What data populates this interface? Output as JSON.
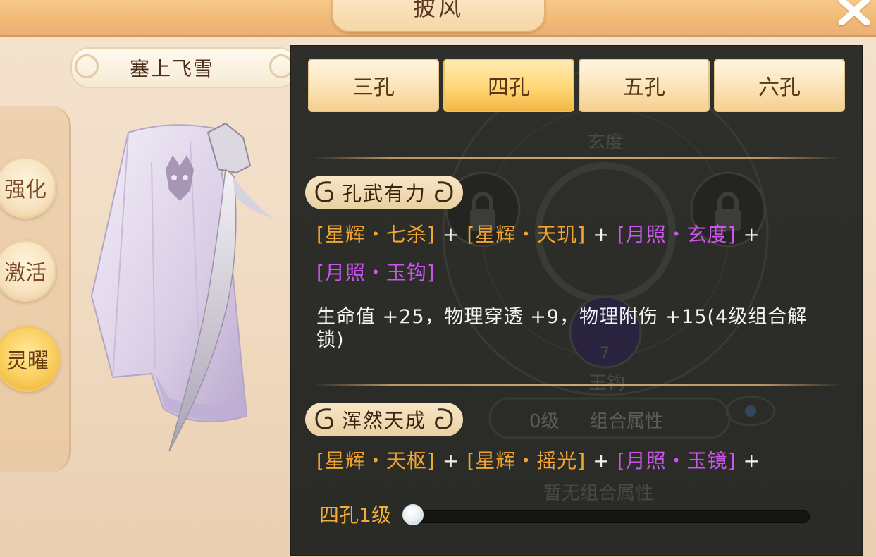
{
  "window": {
    "title": "披风"
  },
  "item": {
    "name": "塞上飞雪"
  },
  "side_menu": [
    {
      "label": "强化",
      "active": false
    },
    {
      "label": "激活",
      "active": false
    },
    {
      "label": "灵曜",
      "active": true
    }
  ],
  "tabs": [
    {
      "label": "三孔",
      "active": false
    },
    {
      "label": "四孔",
      "active": true
    },
    {
      "label": "五孔",
      "active": false
    },
    {
      "label": "六孔",
      "active": false
    }
  ],
  "background_labels": {
    "slot_top": "玄度",
    "slot_bottom": "玉钩",
    "slot_number": "7",
    "level_text": "0级",
    "combo_attr": "组合属性",
    "no_combo": "暂无组合属性"
  },
  "sections": [
    {
      "title": "孔武有力",
      "gems_line1": [
        {
          "text": "[星辉・七杀]",
          "color": "gold"
        },
        {
          "text": "[星辉・天玑]",
          "color": "gold"
        },
        {
          "text": "[月照・玄度]",
          "color": "purple"
        }
      ],
      "gems_line2": [
        {
          "text": "[月照・玉钩]",
          "color": "purple"
        }
      ],
      "effect": "生命值 +25，物理穿透 +9，物理附伤 +15(4级组合解锁)"
    },
    {
      "title": "浑然天成",
      "gems_line1": [
        {
          "text": "[星辉・天枢]",
          "color": "gold"
        },
        {
          "text": "[星辉・摇光]",
          "color": "gold"
        },
        {
          "text": "[月照・玉镜]",
          "color": "purple"
        }
      ]
    }
  ],
  "plus_sign": "+",
  "level_slider": {
    "label": "四孔1级",
    "value": 0
  },
  "colors": {
    "gold": "#f2a631",
    "purple": "#cc55f0",
    "panel": "#2c2d29"
  }
}
